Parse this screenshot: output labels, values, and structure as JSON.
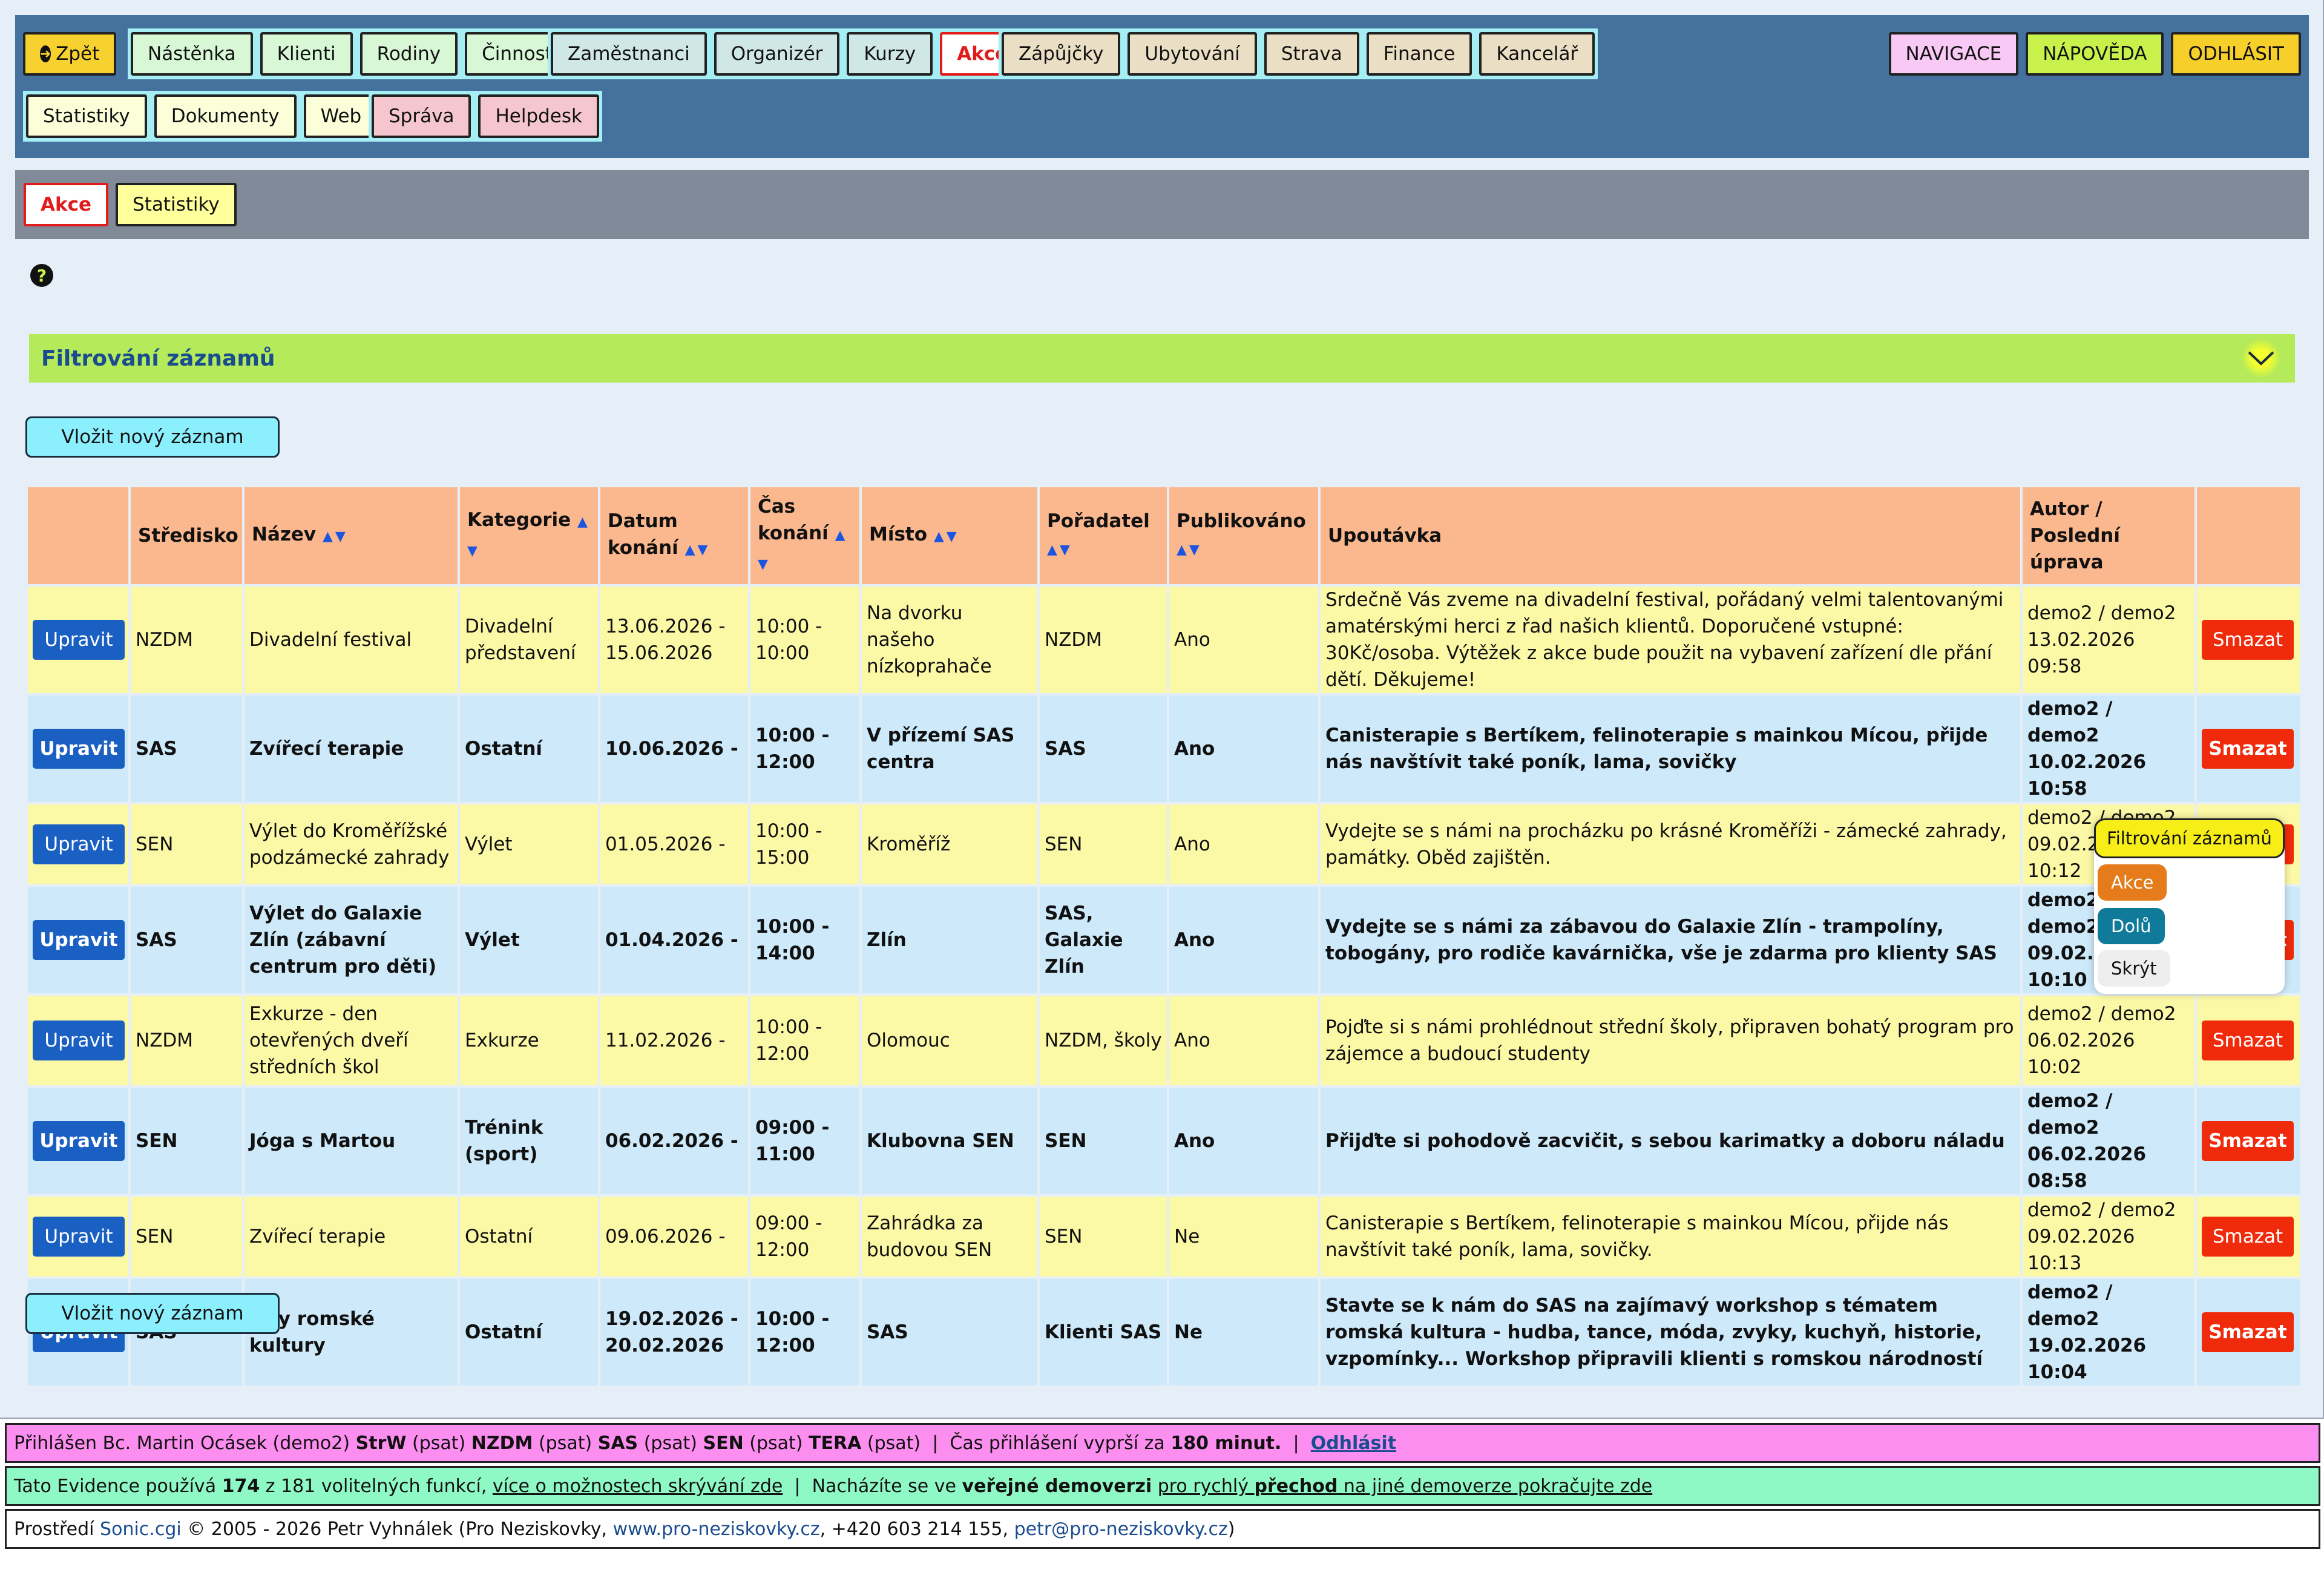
{
  "nav": {
    "back": "Zpět",
    "group1": [
      "Nástěnka",
      "Klienti",
      "Rodiny",
      "Činnosti"
    ],
    "group2": [
      "Zaměstnanci",
      "Organizér",
      "Kurzy",
      "Akce"
    ],
    "group3": [
      "Zápůjčky",
      "Ubytování",
      "Strava",
      "Finance",
      "Kancelář"
    ],
    "group4": [
      "Statistiky",
      "Dokumenty",
      "Web"
    ],
    "group5": [
      "Správa",
      "Helpdesk"
    ],
    "right": [
      "NAVIGACE",
      "NÁPOVĚDA",
      "ODHLÁSIT"
    ]
  },
  "subnav": [
    "Akce",
    "Statistiky"
  ],
  "filter": {
    "title": "Filtrování záznamů"
  },
  "add_button": "Vložit nový záznam",
  "table": {
    "headers": {
      "stredisko": "Středisko",
      "nazev": "Název",
      "kategorie": "Kategorie",
      "datum": "Datum konání",
      "cas": "Čas konání",
      "misto": "Místo",
      "poradatel": "Pořadatel",
      "publikovano": "Publikováno",
      "upoutavka": "Upoutávka",
      "autor": "Autor / Poslední úprava"
    },
    "edit_label": "Upravit",
    "delete_label": "Smazat",
    "rows": [
      {
        "stredisko": "NZDM",
        "nazev": "Divadelní festival",
        "kategorie": "Divadelní představení",
        "datum": "13.06.2026 - 15.06.2026",
        "cas": "10:00 - 10:00",
        "misto": "Na dvorku našeho nízkoprahače",
        "poradatel": "NZDM",
        "publikovano": "Ano",
        "upoutavka": "Srdečně Vás zveme na divadelní festival, pořádaný velmi talentovanými amatérskými herci z řad našich klientů. Doporučené vstupné: 30Kč/osoba. Výtěžek z akce bude použit na vybavení zařízení dle přání dětí. Děkujeme!",
        "autor": "demo2 / demo2 13.02.2026 09:58"
      },
      {
        "stredisko": "SAS",
        "nazev": "Zvířecí terapie",
        "kategorie": "Ostatní",
        "datum": "10.06.2026 -",
        "cas": "10:00 - 12:00",
        "misto": "V přízemí SAS centra",
        "poradatel": "SAS",
        "publikovano": "Ano",
        "upoutavka": "Canisterapie s Bertíkem, felinoterapie s mainkou Mícou, přijde nás navštívit také poník, lama, sovičky",
        "autor": "demo2 / demo2 10.02.2026 10:58"
      },
      {
        "stredisko": "SEN",
        "nazev": "Výlet do Kroměřížské podzámecké zahrady",
        "kategorie": "Výlet",
        "datum": "01.05.2026 -",
        "cas": "10:00 - 15:00",
        "misto": "Kroměříž",
        "poradatel": "SEN",
        "publikovano": "Ano",
        "upoutavka": "Vydejte se s námi na procházku po krásné Kroměříži - zámecké zahrady, památky. Oběd zajištěn.",
        "autor": "demo2 / demo2 09.02.2026 10:12"
      },
      {
        "stredisko": "SAS",
        "nazev": "Výlet do Galaxie Zlín (zábavní centrum pro děti)",
        "kategorie": "Výlet",
        "datum": "01.04.2026 -",
        "cas": "10:00 - 14:00",
        "misto": "Zlín",
        "poradatel": "SAS, Galaxie Zlín",
        "publikovano": "Ano",
        "upoutavka": "Vydejte se s námi za zábavou do Galaxie Zlín - trampolíny, tobogány, pro rodiče kavárnička, vše je zdarma pro klienty SAS",
        "autor": "demo2 / demo2 09.02.2026 10:10"
      },
      {
        "stredisko": "NZDM",
        "nazev": "Exkurze - den otevřených dveří středních škol",
        "kategorie": "Exkurze",
        "datum": "11.02.2026 -",
        "cas": "10:00 - 12:00",
        "misto": "Olomouc",
        "poradatel": "NZDM, školy",
        "publikovano": "Ano",
        "upoutavka": "Pojďte si s námi prohlédnout střední školy, připraven bohatý program pro zájemce a budoucí studenty",
        "autor": "demo2 / demo2 06.02.2026 10:02"
      },
      {
        "stredisko": "SEN",
        "nazev": "Jóga s Martou",
        "kategorie": "Trénink (sport)",
        "datum": "06.02.2026 -",
        "cas": "09:00 - 11:00",
        "misto": "Klubovna SEN",
        "poradatel": "SEN",
        "publikovano": "Ano",
        "upoutavka": "Přijďte si pohodově zacvičit, s sebou karimatky a doboru náladu",
        "autor": "demo2 / demo2 06.02.2026 08:58"
      },
      {
        "stredisko": "SEN",
        "nazev": "Zvířecí terapie",
        "kategorie": "Ostatní",
        "datum": "09.06.2026 -",
        "cas": "09:00 - 12:00",
        "misto": "Zahrádka za budovou SEN",
        "poradatel": "SEN",
        "publikovano": "Ne",
        "upoutavka": "Canisterapie s Bertíkem, felinoterapie s mainkou Mícou, přijde nás navštívit také poník, lama, sovičky.",
        "autor": "demo2 / demo2 09.02.2026 10:13"
      },
      {
        "stredisko": "SAS",
        "nazev": "Dny romské kultury",
        "kategorie": "Ostatní",
        "datum": "19.02.2026 - 20.02.2026",
        "cas": "10:00 - 12:00",
        "misto": "SAS",
        "poradatel": "Klienti SAS",
        "publikovano": "Ne",
        "upoutavka": "Stavte se k nám do SAS na zajímavý workshop s tématem romská kultura - hudba, tance, móda, zvyky, kuchyň, historie, vzpomínky... Workshop připravili klienti s romskou národností",
        "autor": "demo2 / demo2 19.02.2026 10:04"
      }
    ]
  },
  "float_menu": {
    "filter": "Filtrování záznamů",
    "akce": "Akce",
    "dolu": "Dolů",
    "skryt": "Skrýt"
  },
  "footer": {
    "line1": {
      "prefix": "Přihlášen Bc. Martin Ocásek (demo2)",
      "roles": [
        {
          "name": "StrW",
          "mode": "(psat)"
        },
        {
          "name": "NZDM",
          "mode": "(psat)"
        },
        {
          "name": "SAS",
          "mode": "(psat)"
        },
        {
          "name": "SEN",
          "mode": "(psat)"
        },
        {
          "name": "TERA",
          "mode": "(psat)"
        }
      ],
      "sep": "|",
      "expiry_text": "Čas přihlášení vyprší za",
      "expiry_value": "180 minut.",
      "logout": "Odhlásit"
    },
    "line2": {
      "p1": "Tato Evidence používá",
      "used": "174",
      "p2": "z 181 volitelných funkcí,",
      "link1": "více o možnostech skrývání zde",
      "sep": "|",
      "p3": "Nacházíte se ve",
      "demo": "veřejné demoverzi",
      "link2a": "pro rychlý",
      "link2b": "přechod",
      "link2c": "na jiné demoverze pokračujte zde"
    },
    "line3": {
      "p1": "Prostředí",
      "product": "Sonic.cgi",
      "p2": "© 2005 - 2026 Petr Vyhnálek (Pro Neziskovky,",
      "web": "www.pro-neziskovky.cz",
      "p3": ", +420 603 214 155,",
      "email": "petr@pro-neziskovky.cz",
      "p4": ")"
    }
  },
  "colors": {
    "nav_bg": "#44719e",
    "filter_bg": "#b5ea5a",
    "header_bg": "#fbb88e",
    "row_yellow": "#fbf8a6",
    "row_blue": "#cde9fa",
    "edit": "#1a5fc2",
    "delete": "#ef2b0b"
  }
}
